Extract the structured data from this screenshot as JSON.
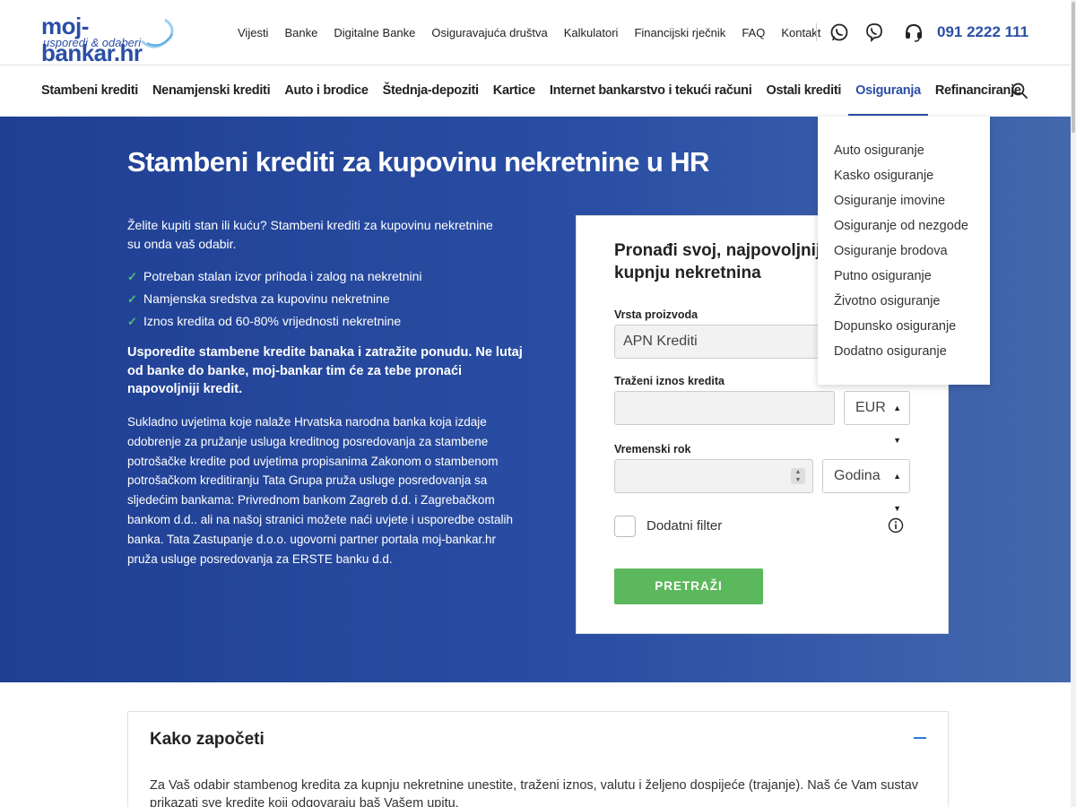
{
  "header": {
    "logo_text": "moj-bankar.hr",
    "logo_tagline": "usporedi & odaberi",
    "top_links": [
      "Vijesti",
      "Banke",
      "Digitalne Banke",
      "Osiguravajuća društva",
      "Kalkulatori",
      "Financijski rječnik",
      "FAQ",
      "Kontakt"
    ],
    "phone": "091 2222 111",
    "icons": [
      "whatsapp-icon",
      "viber-icon",
      "headset-icon"
    ]
  },
  "nav": {
    "items": [
      "Stambeni krediti",
      "Nenamjenski krediti",
      "Auto i brodice",
      "Štednja-depoziti",
      "Kartice",
      "Internet bankarstvo i tekući računi",
      "Ostali krediti",
      "Osiguranja",
      "Refinanciranje"
    ],
    "active_index": 7
  },
  "dropdown": {
    "items": [
      "Auto osiguranje",
      "Kasko osiguranje",
      "Osiguranje imovine",
      "Osiguranje od nezgode",
      "Osiguranje brodova",
      "Putno osiguranje",
      "Životno osiguranje",
      "Dopunsko osiguranje",
      "Dodatno osiguranje"
    ]
  },
  "hero": {
    "title": "Stambeni krediti za kupovinu nekretnine u HR",
    "intro": "Želite kupiti stan ili kuću? Stambeni krediti za kupovinu nekretnine su onda vaš odabir.",
    "bullets": [
      "Potreban stalan izvor prihoda i zalog na nekretnini",
      "Namjenska sredstva za kupovinu nekretnine",
      "Iznos kredita od 60-80% vrijednosti nekretnine"
    ],
    "bold": "Usporedite stambene kredite banaka i zatražite ponudu. Ne lutaj od banke do banke, moj-bankar tim će za tebe pronaći napovoljniji kredit.",
    "small": "Sukladno uvjetima koje nalaže Hrvatska narodna banka koja izdaje odobrenje za pružanje usluga kreditnog posredovanja za stambene potrošačke kredite pod uvjetima propisanima Zakonom o stambenom potrošačkom kreditiranju Tata Grupa pruža usluge posredovanja sa sljedećim bankama: Privrednom bankom Zagreb d.d. i Zagrebačkom bankom d.d.. ali na našoj stranici možete naći uvjete i usporedbe ostalih banka. Tata Zastupanje d.o.o. ugovorni partner portala moj-bankar.hr pruža usluge posredovanja za ERSTE banku d.d."
  },
  "form": {
    "title": "Pronađi svoj, najpovoljniji kredit za kupnju nekretnina",
    "product_label": "Vrsta proizvoda",
    "product_value": "APN Krediti",
    "amount_label": "Traženi iznos kredita",
    "amount_value": "",
    "currency": "EUR",
    "term_label": "Vremenski rok",
    "term_value": "",
    "term_unit": "Godina",
    "filter_label": "Dodatni filter",
    "filter_checked": false,
    "submit": "PRETRAŽI"
  },
  "accordion": {
    "title": "Kako započeti",
    "text": "Za Vaš odabir stambenog kredita za kupnju nekretnine unestite, traženi iznos, valutu i željeno dospijeće (trajanje). Naš će Vam sustav prikazati sve kredite koji odgovaraju baš Vašem upitu."
  },
  "colors": {
    "brand": "#2b4fa6",
    "hero_start": "#1f3f93",
    "hero_end": "#4468ad",
    "button": "#5cb85c",
    "check": "#4fc16b",
    "accordion_toggle": "#2b7bd6"
  }
}
